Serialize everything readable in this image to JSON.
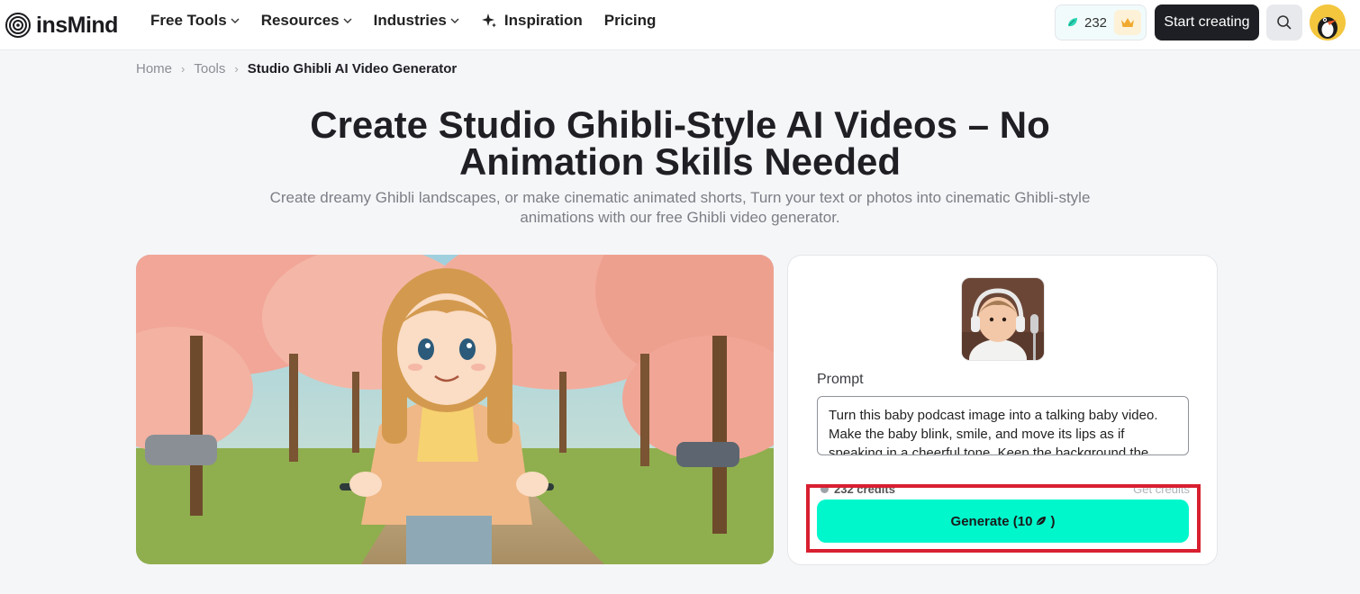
{
  "brand": {
    "name": "insMind"
  },
  "nav": {
    "items": [
      {
        "label": "Free Tools",
        "has_dropdown": true
      },
      {
        "label": "Resources",
        "has_dropdown": true
      },
      {
        "label": "Industries",
        "has_dropdown": true
      },
      {
        "label": "Inspiration",
        "icon": "sparkle-icon"
      },
      {
        "label": "Pricing"
      }
    ]
  },
  "header": {
    "credits": "232",
    "start_label": "Start creating",
    "icons": {
      "credits": "credits-gem-icon",
      "crown": "crown-icon",
      "search": "search-icon"
    }
  },
  "breadcrumb": {
    "items": [
      "Home",
      "Tools"
    ],
    "current": "Studio Ghibli AI Video Generator"
  },
  "hero": {
    "title_line1": "Create Studio Ghibli-Style AI Videos – No",
    "title_line2": "Animation Skills Needed",
    "subtitle_line1": "Create dreamy Ghibli landscapes, or make cinematic animated shorts, Turn your text or photos into cinematic Ghibli-style",
    "subtitle_line2": "animations with our free Ghibli video generator."
  },
  "panel": {
    "prompt_label": "Prompt",
    "prompt_text": "Turn this baby podcast image into a talking baby video. Make the baby blink, smile, and move its lips as if speaking in a cheerful tone. Keep the background the",
    "credits_text": "232 credits",
    "get_credits": "Get credits",
    "generate_label": "Generate (10",
    "generate_close": ")"
  },
  "colors": {
    "accent": "#00f7cc",
    "highlight": "#d81f30",
    "dark_button": "#1e1f24"
  }
}
